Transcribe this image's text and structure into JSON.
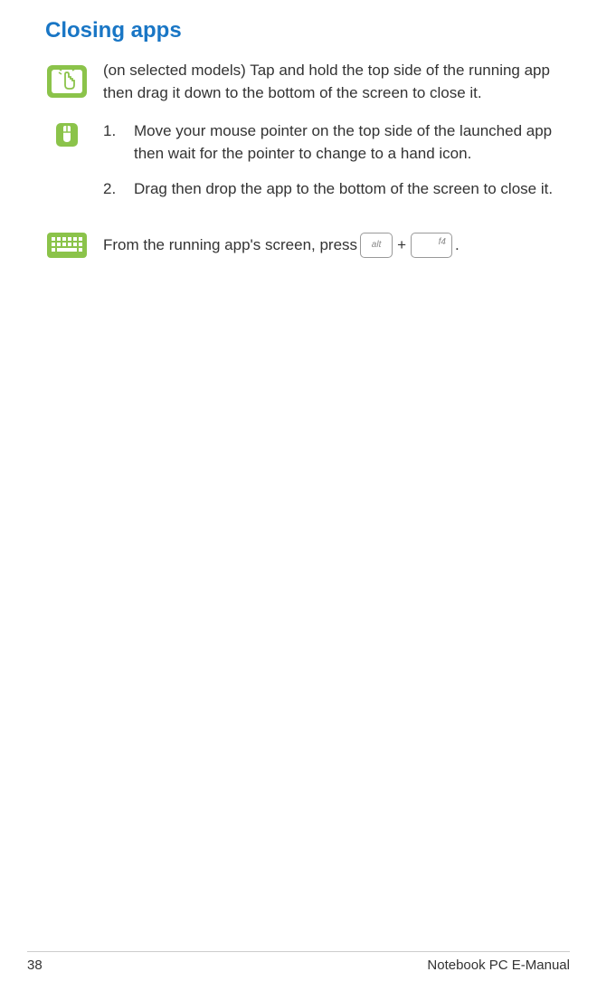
{
  "title": "Closing apps",
  "touch": {
    "text": "(on selected models) Tap and hold the top side of the running app then drag it down to the bottom of the screen to close it."
  },
  "mouse": {
    "items": [
      {
        "num": "1.",
        "text": "Move your mouse pointer on the top side of the launched app then wait for the pointer to change to a hand icon."
      },
      {
        "num": "2.",
        "text": "Drag then drop the app to the bottom of the screen to close it."
      }
    ]
  },
  "keyboard": {
    "prefix": "From the running app's screen, press ",
    "key1": "alt",
    "plus": "+",
    "key2": "f4",
    "suffix": "."
  },
  "footer": {
    "page": "38",
    "doc": "Notebook PC E-Manual"
  }
}
